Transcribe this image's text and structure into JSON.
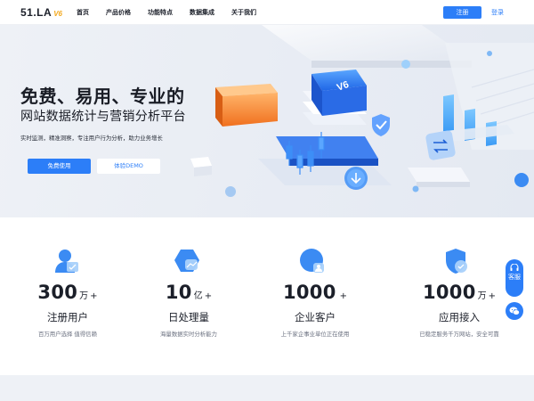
{
  "nav": {
    "logo_main": "51.LA",
    "logo_version": "V6",
    "items": [
      {
        "label": "首页"
      },
      {
        "label": "产品价格"
      },
      {
        "label": "功能特点"
      },
      {
        "label": "数据集成"
      },
      {
        "label": "关于我们"
      }
    ],
    "register_label": "注册",
    "login_label": "登录"
  },
  "hero": {
    "title": "免费、易用、专业的",
    "subtitle": "网站数据统计与营销分析平台",
    "description": "实时监测，精准洞察，专注用户行为分析，助力业务增长",
    "primary_button": "免费使用",
    "secondary_button": "体验DEMO",
    "badge_text": "V6"
  },
  "stats": [
    {
      "number": "300",
      "unit": "万",
      "plus": "+",
      "label": "注册用户",
      "desc": "百万用户选择 值得信赖",
      "icon": "user-icon"
    },
    {
      "number": "10",
      "unit": "亿",
      "plus": "+",
      "label": "日处理量",
      "desc": "海量数据实时分析能力",
      "icon": "hexagon-chart-icon"
    },
    {
      "number": "1000",
      "unit": "",
      "plus": "+",
      "label": "企业客户",
      "desc": "上千家企事业单位正在使用",
      "icon": "enterprise-icon"
    },
    {
      "number": "1000",
      "unit": "万",
      "plus": "+",
      "label": "应用接入",
      "desc": "已稳定服务千万网站，安全可靠",
      "icon": "shield-icon"
    }
  ],
  "float": {
    "service_label": "客服"
  },
  "colors": {
    "accent": "#2c7ef8",
    "logo_version": "#f3a81c",
    "hero_bg": "#eaeef5"
  }
}
